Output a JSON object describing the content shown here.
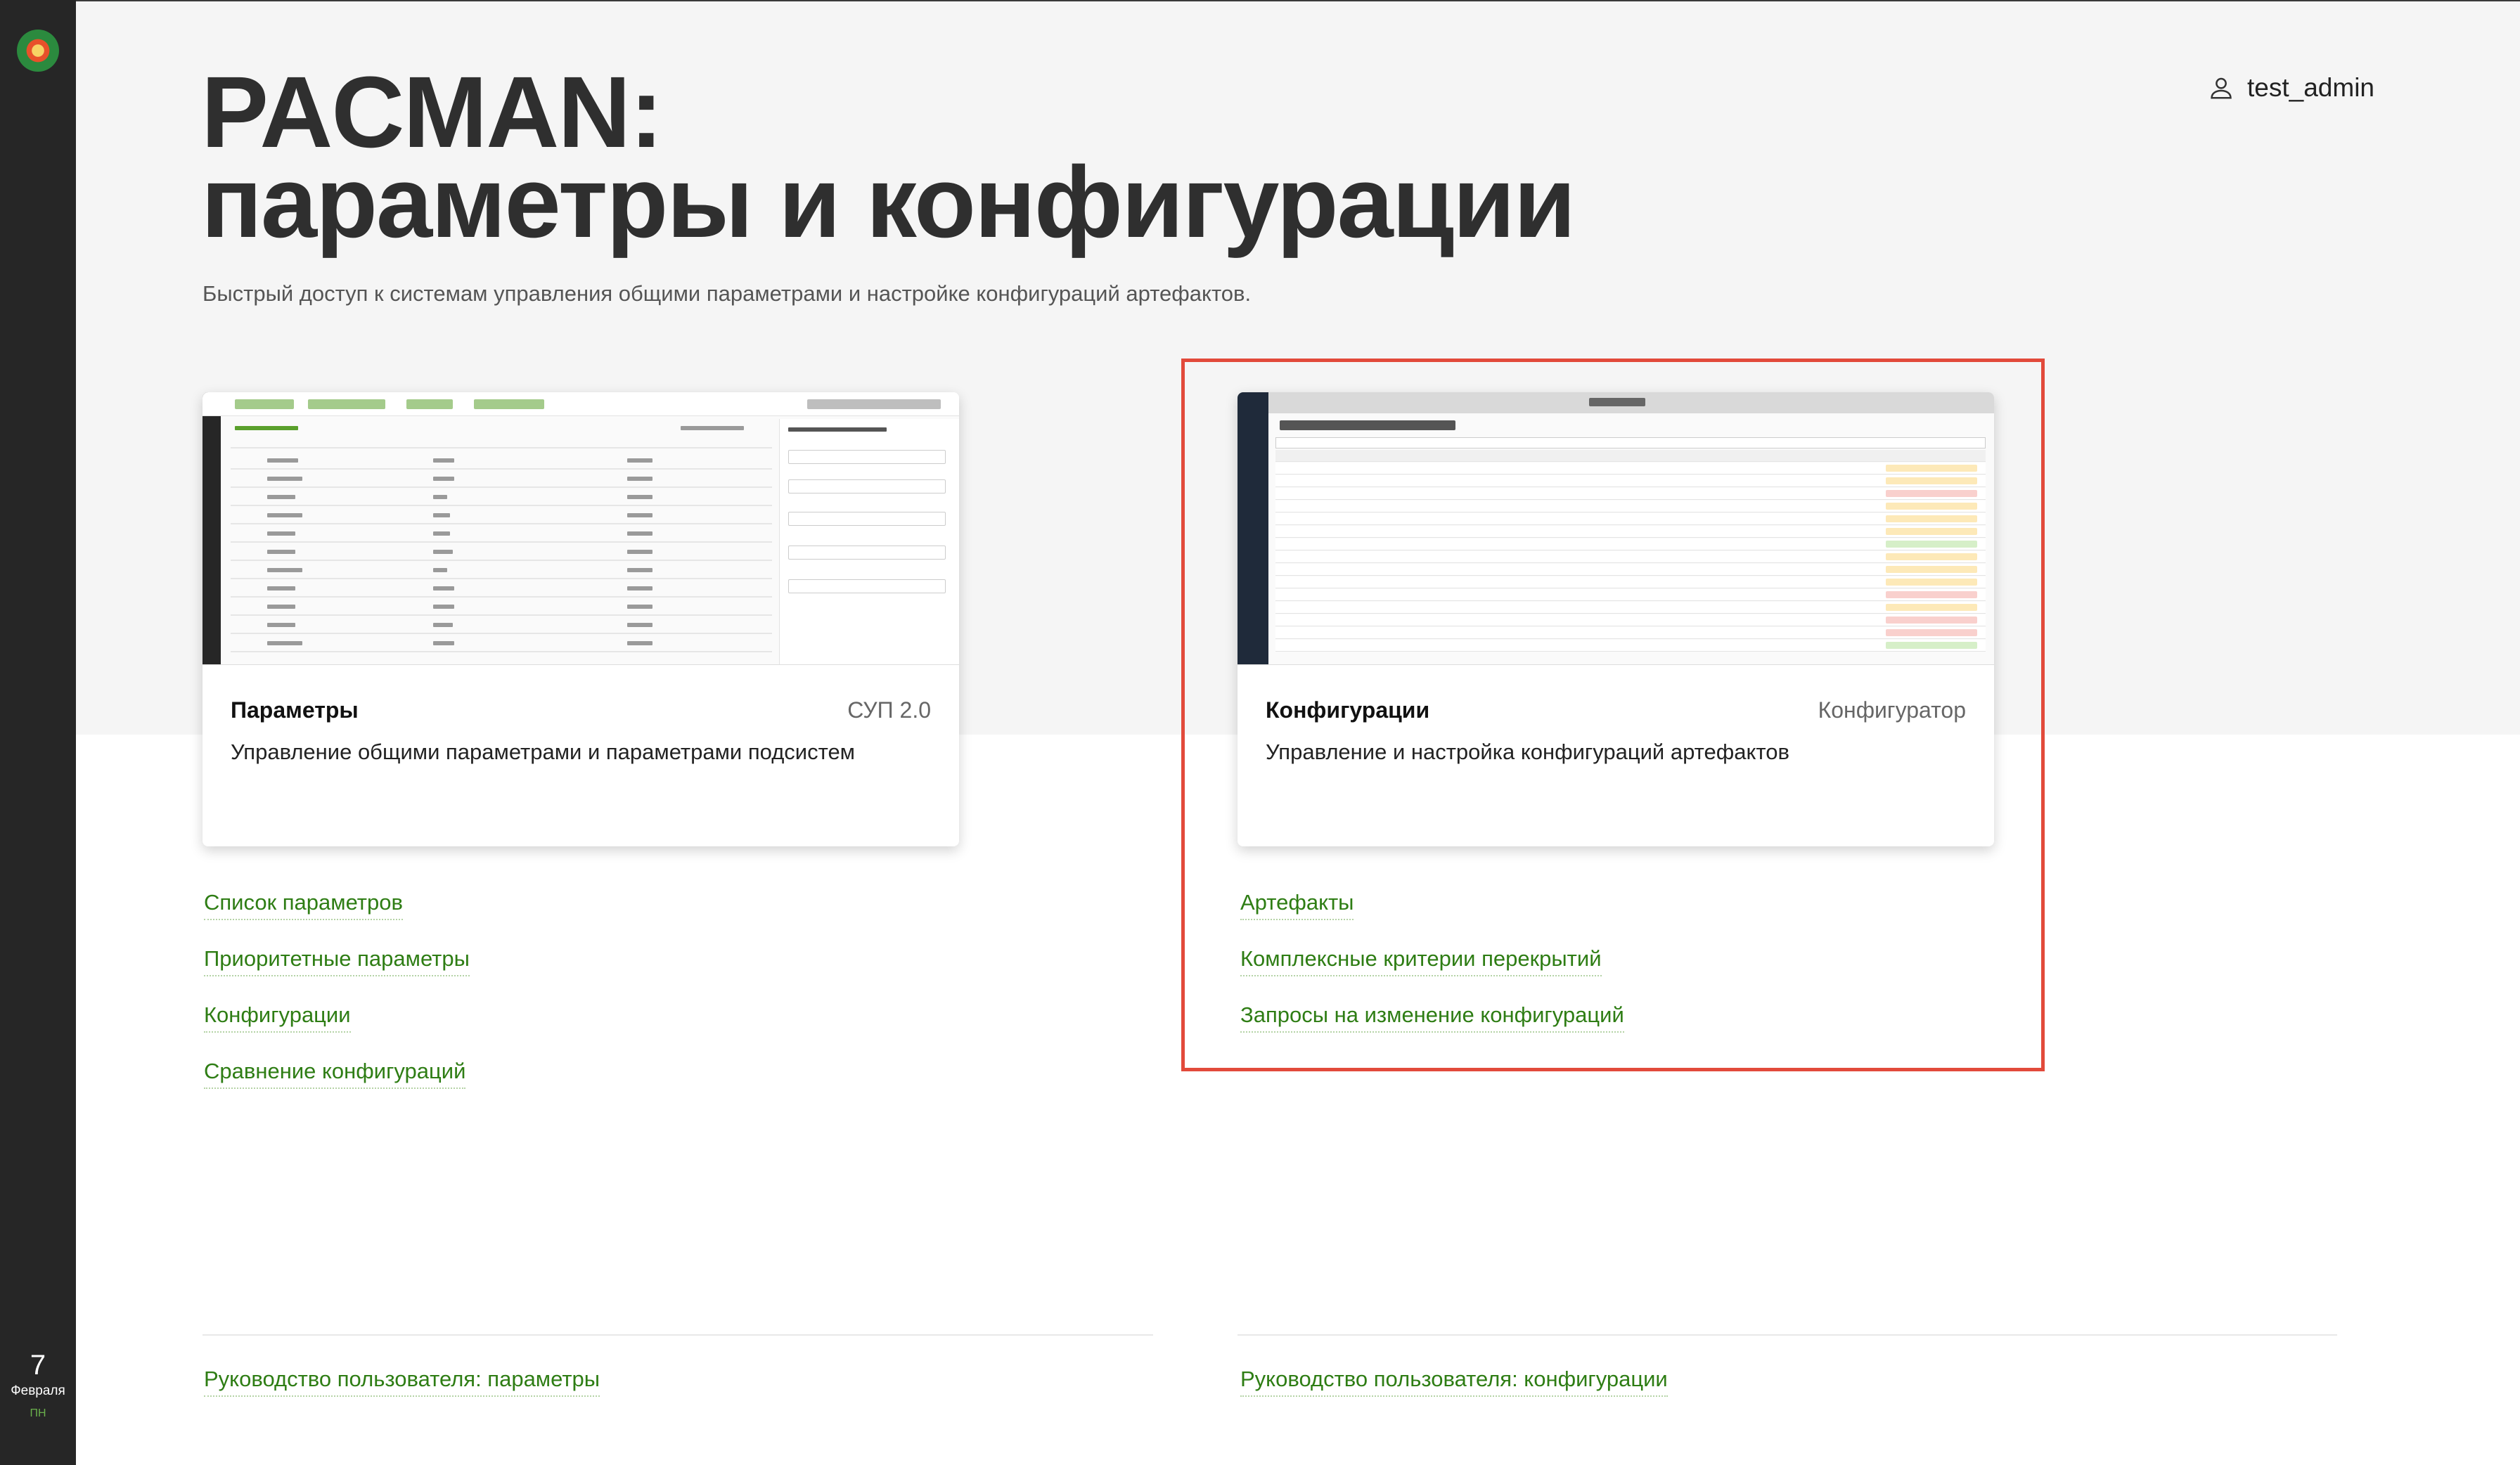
{
  "user": {
    "name": "test_admin",
    "icon": "user-icon"
  },
  "page": {
    "title_line1": "PACMAN:",
    "title_line2": "параметры и конфигурации",
    "subtitle": "Быстрый доступ к системам управления общими параметрами и настройке конфигураций артефактов."
  },
  "rail": {
    "day": "7",
    "month": "Февраля",
    "weekday": "ПН"
  },
  "cards": {
    "params": {
      "name": "Параметры",
      "tag": "СУП 2.0",
      "description": "Управление общими параметрами и параметрами подсистем",
      "links": [
        "Список параметров",
        "Приоритетные параметры",
        "Конфигурации",
        "Сравнение конфигураций"
      ]
    },
    "configs": {
      "name": "Конфигурации",
      "tag": "Конфигуратор",
      "description": "Управление и настройка конфигураций артефактов",
      "links": [
        "Артефакты",
        "Комплексные критерии перекрытий",
        "Запросы на изменение конфигураций"
      ]
    }
  },
  "footer": {
    "guide_params": "Руководство пользователя: параметры",
    "guide_configs": "Руководство пользователя: конфигурации"
  },
  "colors": {
    "accent": "#2e7d14",
    "highlight": "#e24a3b",
    "rail": "#262626"
  }
}
